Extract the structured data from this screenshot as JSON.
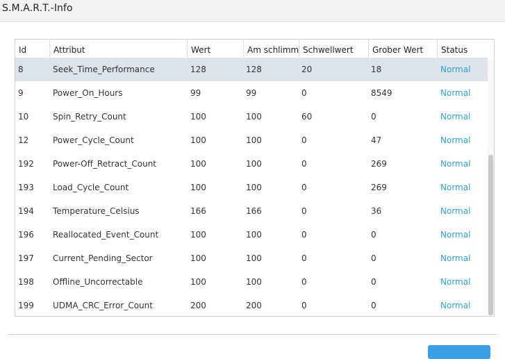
{
  "window": {
    "title": "S.M.A.R.T.-Info"
  },
  "table": {
    "columns": [
      "Id",
      "Attribut",
      "Wert",
      "Am schlimmsten",
      "Schwellwert",
      "Grober Wert",
      "Status"
    ],
    "rows": [
      {
        "id": "8",
        "attribute": "Seek_Time_Performance",
        "value": "128",
        "worst": "128",
        "threshold": "20",
        "raw": "18",
        "status": "Normal",
        "selected": true
      },
      {
        "id": "9",
        "attribute": "Power_On_Hours",
        "value": "99",
        "worst": "99",
        "threshold": "0",
        "raw": "8549",
        "status": "Normal"
      },
      {
        "id": "10",
        "attribute": "Spin_Retry_Count",
        "value": "100",
        "worst": "100",
        "threshold": "60",
        "raw": "0",
        "status": "Normal"
      },
      {
        "id": "12",
        "attribute": "Power_Cycle_Count",
        "value": "100",
        "worst": "100",
        "threshold": "0",
        "raw": "47",
        "status": "Normal"
      },
      {
        "id": "192",
        "attribute": "Power-Off_Retract_Count",
        "value": "100",
        "worst": "100",
        "threshold": "0",
        "raw": "269",
        "status": "Normal"
      },
      {
        "id": "193",
        "attribute": "Load_Cycle_Count",
        "value": "100",
        "worst": "100",
        "threshold": "0",
        "raw": "269",
        "status": "Normal"
      },
      {
        "id": "194",
        "attribute": "Temperature_Celsius",
        "value": "166",
        "worst": "166",
        "threshold": "0",
        "raw": "36",
        "status": "Normal"
      },
      {
        "id": "196",
        "attribute": "Reallocated_Event_Count",
        "value": "100",
        "worst": "100",
        "threshold": "0",
        "raw": "0",
        "status": "Normal"
      },
      {
        "id": "197",
        "attribute": "Current_Pending_Sector",
        "value": "100",
        "worst": "100",
        "threshold": "0",
        "raw": "0",
        "status": "Normal"
      },
      {
        "id": "198",
        "attribute": "Offline_Uncorrectable",
        "value": "100",
        "worst": "100",
        "threshold": "0",
        "raw": "0",
        "status": "Normal"
      },
      {
        "id": "199",
        "attribute": "UDMA_CRC_Error_Count",
        "value": "200",
        "worst": "200",
        "threshold": "0",
        "raw": "0",
        "status": "Normal"
      }
    ]
  },
  "colors": {
    "status_text": "#2aa3d6",
    "selected_row": "#dde3ea",
    "primary_button": "#3aa0ea"
  }
}
